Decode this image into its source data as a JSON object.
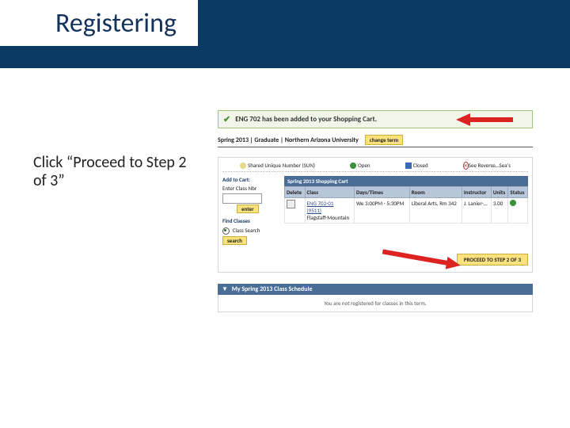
{
  "title": "Registering",
  "instruction": "Click “Proceed to Step 2 of 3”",
  "confirm_msg": "ENG 702 has been added to your Shopping Cart.",
  "term_line": "Spring 2013 | Graduate | Northern Arizona University",
  "change_term": "change term",
  "legend": {
    "sun": "Shared Unique Number (SUN)",
    "open": "Open",
    "closed": "Closed",
    "reverse": "See Reverse…Sea's"
  },
  "addcart": {
    "hdr": "Add to Cart:",
    "enter_label": "Enter Class Nbr",
    "enter_btn": "enter",
    "find_hdr": "Find Classes",
    "class_search": "Class Search",
    "search_btn": "search"
  },
  "cart": {
    "title": "Spring 2013 Shopping Cart",
    "cols": {
      "delete": "Delete",
      "class": "Class",
      "days": "Days/Times",
      "room": "Room",
      "instr": "Instructor",
      "units": "Units",
      "status": "Status"
    },
    "row": {
      "class_link": "ENG 702-01",
      "class_sub1": "(9511)",
      "class_sub2": "Flagstaff-Mountain",
      "days": "We 3:00PM - 5:30PM",
      "room": "Liberal Arts, Rm 342",
      "instr": "J. Lanier-…",
      "units": "3.00"
    }
  },
  "proceed_btn": "PROCEED TO STEP 2 OF 3",
  "schedule": {
    "hdr": "My Spring 2013 Class Schedule",
    "empty": "You are not registered for classes in this term."
  }
}
